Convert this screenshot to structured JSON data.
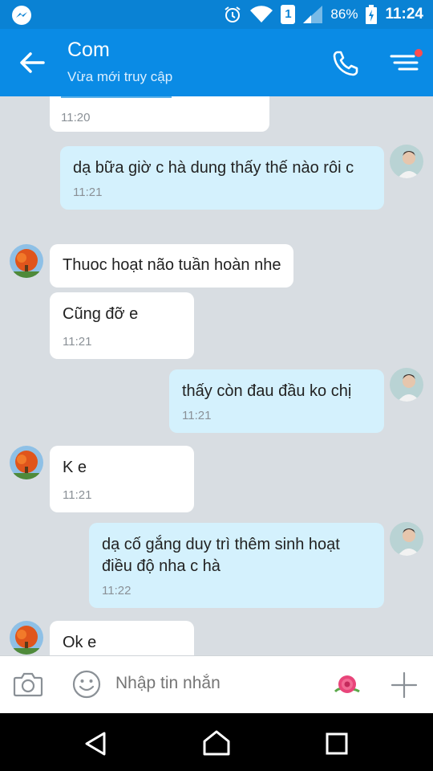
{
  "status_bar": {
    "battery_pct": "86%",
    "time": "11:24",
    "sim_label": "1"
  },
  "header": {
    "title": "Com",
    "subtitle": "Vừa mới truy cập"
  },
  "messages": [
    {
      "side": "in",
      "text": "",
      "time": "11:20"
    },
    {
      "side": "out",
      "text": "dạ bữa giờ c hà dung thấy thế nào rôi c",
      "time": "11:21"
    },
    {
      "side": "in",
      "text": "Thuoc hoạt não tuần hoàn nhe",
      "time": ""
    },
    {
      "side": "in",
      "text": "Cũng đỡ e",
      "time": "11:21"
    },
    {
      "side": "out",
      "text": "thấy còn đau đầu ko chị",
      "time": "11:21"
    },
    {
      "side": "in",
      "text": "K e",
      "time": "11:21"
    },
    {
      "side": "out",
      "text": "dạ cố gắng duy trì thêm sinh hoạt điều độ nha c hà",
      "time": "11:22"
    },
    {
      "side": "in",
      "text": "Ok e",
      "time": ""
    }
  ],
  "input": {
    "placeholder": "Nhập tin nhắn"
  },
  "colors": {
    "header_bg": "#0a8be5",
    "status_bg": "#0a82d4",
    "chat_bg": "#d8dde2",
    "out_bubble": "#d4f1fd",
    "in_bubble": "#ffffff"
  },
  "icons": {
    "status_left": "messenger-icon",
    "back": "arrow-left-icon",
    "call": "phone-icon",
    "menu": "menu-icon",
    "camera": "camera-icon",
    "emoji": "smiley-icon",
    "sticker": "flower-sticker-icon",
    "plus": "plus-icon"
  }
}
